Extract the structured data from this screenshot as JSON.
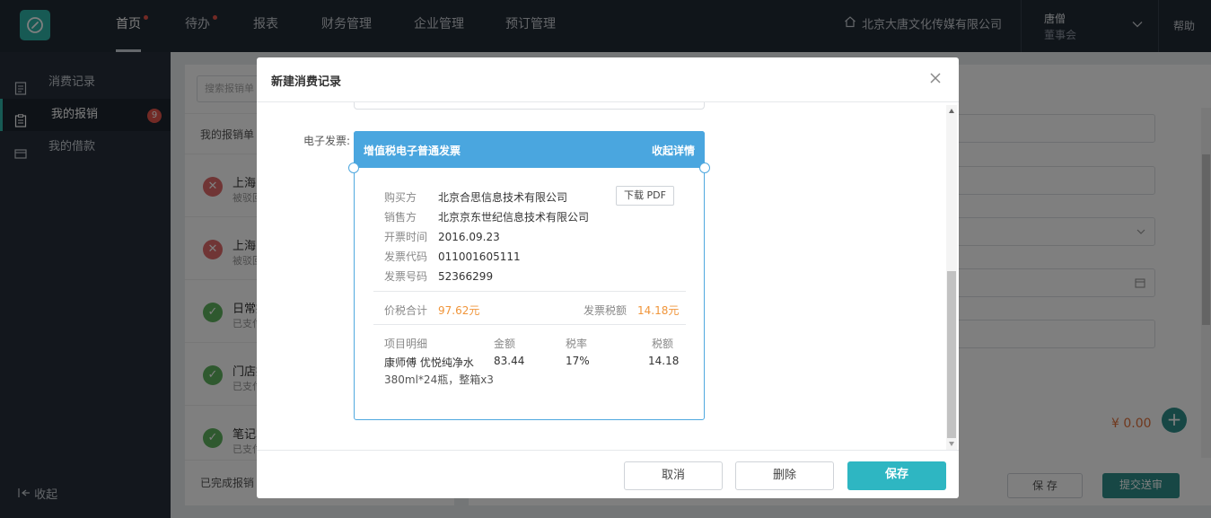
{
  "topbar": {
    "nav": [
      {
        "label": "首页",
        "dot": true,
        "active": true
      },
      {
        "label": "待办",
        "dot": true
      },
      {
        "label": "报表"
      },
      {
        "label": "财务管理"
      },
      {
        "label": "企业管理"
      },
      {
        "label": "预订管理"
      }
    ],
    "company": "北京大唐文化传媒有限公司",
    "user_name": "唐僧",
    "user_role": "董事会",
    "help": "帮助"
  },
  "sidebar": {
    "items": [
      {
        "label": "消费记录"
      },
      {
        "label": "我的报销",
        "badge": "9",
        "active": true
      },
      {
        "label": "我的借款"
      }
    ],
    "collapse": "收起"
  },
  "background": {
    "search_placeholder": "搜索报销单",
    "list_title": "我的报销单",
    "records": [
      {
        "title": "上海出",
        "sub": "被驳回",
        "status": "rejected"
      },
      {
        "title": "上海出",
        "sub": "被驳回",
        "status": "rejected"
      },
      {
        "title": "日常报",
        "sub": "已支付",
        "status": "done"
      },
      {
        "title": "门店报",
        "sub": "已支付",
        "status": "done"
      },
      {
        "title": "笔记本",
        "sub": "已支付",
        "status": "done"
      }
    ],
    "list_footer": "已完成报销",
    "total": "¥ 0.00",
    "save": "保 存",
    "submit": "提交送审"
  },
  "modal": {
    "title": "新建消费记录",
    "field_label": "电子发票:",
    "invoice": {
      "type": "增值税电子普通发票",
      "collapse": "收起详情",
      "download": "下载 PDF",
      "rows": [
        {
          "k": "购买方",
          "v": "北京合思信息技术有限公司"
        },
        {
          "k": "销售方",
          "v": "北京京东世纪信息技术有限公司"
        },
        {
          "k": "开票时间",
          "v": "2016.09.23"
        },
        {
          "k": "发票代码",
          "v": "011001605111"
        },
        {
          "k": "发票号码",
          "v": "52366299"
        }
      ],
      "total_label": "价税合计",
      "total_value": "97.62元",
      "tax_label": "发票税额",
      "tax_value": "14.18元",
      "table": {
        "headers": [
          "项目明细",
          "金额",
          "税率",
          "税额"
        ],
        "item": "康师傅 优悦纯净水",
        "item_line2": "380ml*24瓶，整箱x3",
        "amount": "83.44",
        "rate": "17%",
        "tax": "14.18"
      }
    },
    "buttons": {
      "cancel": "取消",
      "delete": "删除",
      "save": "保存"
    }
  }
}
